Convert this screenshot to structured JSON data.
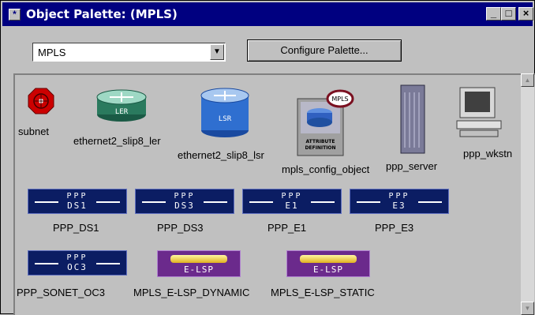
{
  "window": {
    "title": "Object Palette: (MPLS)",
    "title_icon": "asterisk-icon",
    "controls": [
      "minimize",
      "maximize",
      "close"
    ]
  },
  "toolbar": {
    "palette_select_value": "MPLS",
    "configure_label": "Configure Palette..."
  },
  "objects": [
    {
      "label": "subnet",
      "icon": "subnet-icon"
    },
    {
      "label": "ethernet2_slip8_ler",
      "icon": "ler-router-icon",
      "badge": "LER"
    },
    {
      "label": "ethernet2_slip8_lsr",
      "icon": "lsr-router-icon",
      "badge": "LSR"
    },
    {
      "label": "mpls_config_object",
      "icon": "attribute-definition-icon",
      "badge": "MPLS",
      "caption": "ATTRIBUTE DEFINITION"
    },
    {
      "label": "ppp_server",
      "icon": "server-icon"
    },
    {
      "label": "ppp_wkstn",
      "icon": "workstation-icon"
    }
  ],
  "links": [
    {
      "label": "PPP_DS1",
      "top": "PPP",
      "bottom": "DS1"
    },
    {
      "label": "PPP_DS3",
      "top": "PPP",
      "bottom": "DS3"
    },
    {
      "label": "PPP_E1",
      "top": "PPP",
      "bottom": "E1"
    },
    {
      "label": "PPP_E3",
      "top": "PPP",
      "bottom": "E3"
    },
    {
      "label": "PPP_SONET_OC3",
      "top": "PPP",
      "bottom": "OC3"
    }
  ],
  "lsps": [
    {
      "label": "MPLS_E-LSP_DYNAMIC",
      "text": "E-LSP"
    },
    {
      "label": "MPLS_E-LSP_STATIC",
      "text": "E-LSP"
    }
  ],
  "colors": {
    "titlebar": "#000080",
    "link_bg": "#0b1d63",
    "lsp_bg": "#6b2a8c"
  }
}
